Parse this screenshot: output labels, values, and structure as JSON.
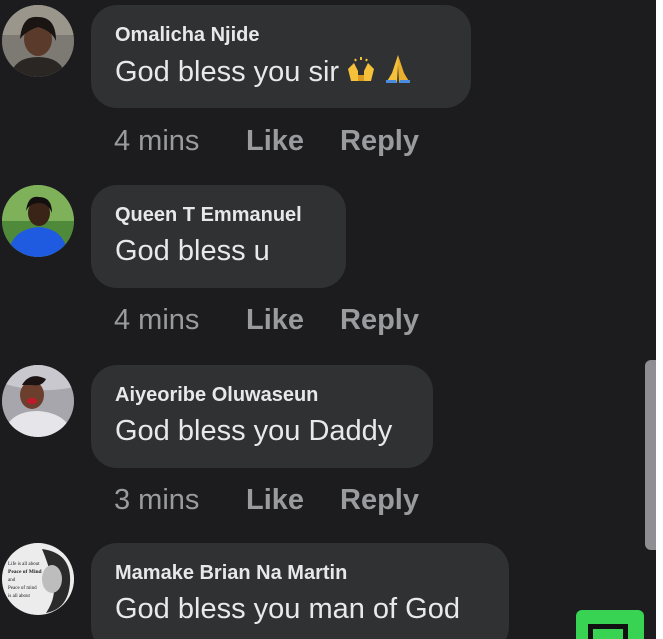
{
  "comments": [
    {
      "author": "Omalicha Njide",
      "text": "God bless you sir",
      "emojis": [
        "raising-hands-icon",
        "folded-hands-icon"
      ],
      "time": "4 mins",
      "like_label": "Like",
      "reply_label": "Reply"
    },
    {
      "author": "Queen T Emmanuel",
      "text": "God bless u",
      "time": "4 mins",
      "like_label": "Like",
      "reply_label": "Reply"
    },
    {
      "author": "Aiyeoribe Oluwaseun",
      "text": "God bless you Daddy",
      "time": "3 mins",
      "like_label": "Like",
      "reply_label": "Reply"
    },
    {
      "author": "Mamake Brian Na Martin",
      "text": "God bless you man of God",
      "avatar_text": "Life is all about Peace of Mind and Peace of mind is all about",
      "avatar_emphasis": "Peace of Mind"
    }
  ],
  "colors": {
    "background": "#1c1c1e",
    "bubble": "#303133",
    "secondary_text": "#9a9b9f",
    "fab": "#39d353"
  }
}
